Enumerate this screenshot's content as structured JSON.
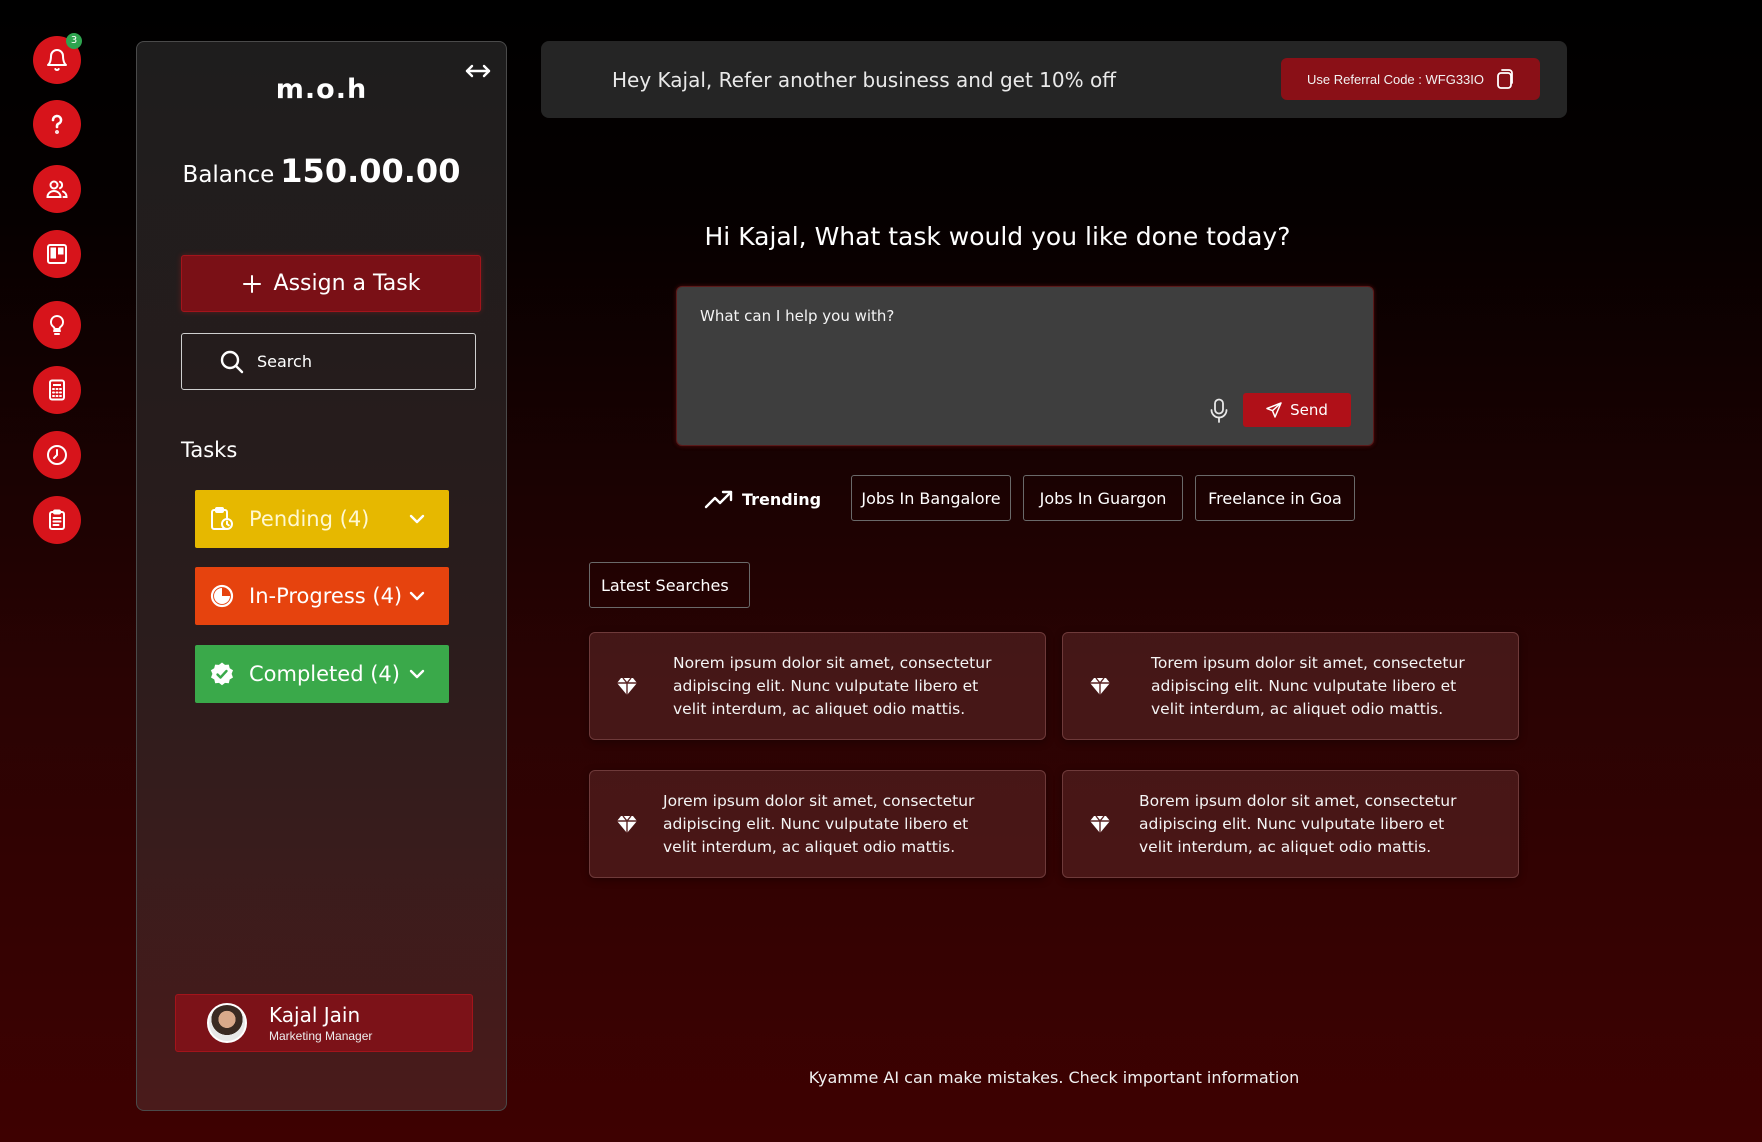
{
  "rail": {
    "notification_count": "3",
    "items": [
      {
        "icon": "bell-icon"
      },
      {
        "icon": "help-icon"
      },
      {
        "icon": "team-icon"
      },
      {
        "icon": "board-icon"
      },
      {
        "icon": "lightbulb-icon"
      },
      {
        "icon": "calculator-icon"
      },
      {
        "icon": "clock-icon"
      },
      {
        "icon": "clipboard-icon"
      }
    ]
  },
  "sidebar": {
    "logo": "m.o.h",
    "balance_label": "Balance",
    "balance_amount": "150.00.00",
    "assign_label": "Assign a Task",
    "search_placeholder": "Search",
    "tasks_heading": "Tasks",
    "tasks": [
      {
        "label": "Pending (4)",
        "color": "#e6b800"
      },
      {
        "label": "In-Progress (4)",
        "color": "#e6430e"
      },
      {
        "label": "Completed (4)",
        "color": "#3aa94a"
      }
    ],
    "profile": {
      "name": "Kajal Jain",
      "role": "Marketing Manager"
    }
  },
  "banner": {
    "message": "Hey Kajal, Refer another business and get 10% off",
    "referral_label": "Use Referral Code : WFG33IO"
  },
  "main": {
    "greeting": "Hi Kajal, What task would you like done today?",
    "prompt_placeholder": "What can I help you with?",
    "send_label": "Send",
    "trending_label": "Trending",
    "trending_chips": [
      "Jobs In Bangalore",
      "Jobs In Guargon",
      "Freelance in Goa"
    ],
    "latest_label": "Latest Searches",
    "cards": [
      "Norem ipsum dolor sit amet, consectetur adipiscing elit. Nunc vulputate libero et velit interdum, ac aliquet odio mattis.",
      "Torem ipsum dolor sit amet, consectetur adipiscing elit. Nunc vulputate libero et velit interdum, ac aliquet odio mattis.",
      "Jorem ipsum dolor sit amet, consectetur adipiscing elit. Nunc vulputate libero et velit interdum, ac aliquet odio mattis.",
      "Borem ipsum dolor sit amet, consectetur adipiscing elit. Nunc vulputate libero et velit interdum, ac aliquet odio mattis."
    ],
    "footer": "Kyamme AI can make mistakes. Check important information"
  },
  "colors": {
    "accent": "#d7141b",
    "accent_dark": "#7a1016",
    "banner_bg": "#252525"
  }
}
